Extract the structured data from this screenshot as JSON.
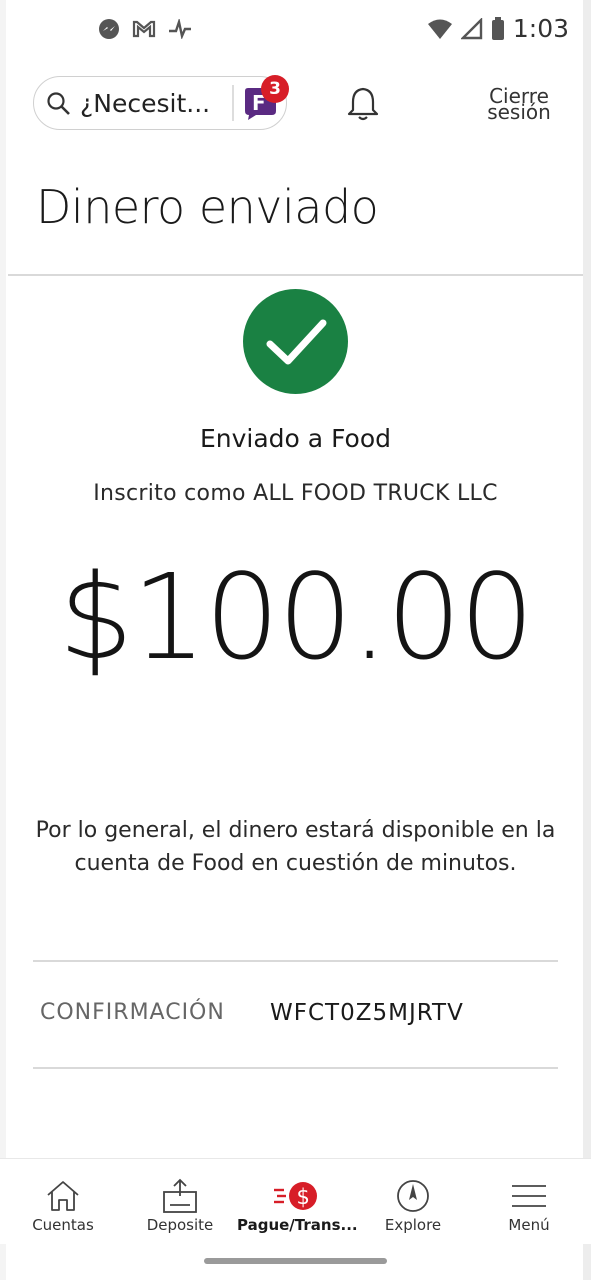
{
  "status_bar": {
    "time": "1:03"
  },
  "header": {
    "search_placeholder": "¿Necesit...",
    "notification_count": "3",
    "signout_line1": "Cierre",
    "signout_line2": "sesión"
  },
  "page": {
    "title": "Dinero enviado",
    "sent_to": "Enviado a Food",
    "enrolled_as": "Inscrito como ALL FOOD TRUCK LLC",
    "amount": "$100.00",
    "availability_note": "Por lo general, el dinero estará disponible en la cuenta de Food en cuestión de minutos.",
    "confirmation_label": "CONFIRMACIÓN",
    "confirmation_value": "WFCT0Z5MJRTV"
  },
  "colors": {
    "success_green": "#1a8143",
    "brand_red": "#d71e28",
    "badge_purple": "#5a2a82"
  },
  "bottom_nav": {
    "items": [
      {
        "label": "Cuentas",
        "icon": "home-icon"
      },
      {
        "label": "Deposite",
        "icon": "deposit-icon"
      },
      {
        "label": "Pague/Trans...",
        "icon": "pay-transfer-icon",
        "active": true
      },
      {
        "label": "Explore",
        "icon": "compass-icon"
      },
      {
        "label": "Menú",
        "icon": "hamburger-menu-icon"
      }
    ]
  }
}
